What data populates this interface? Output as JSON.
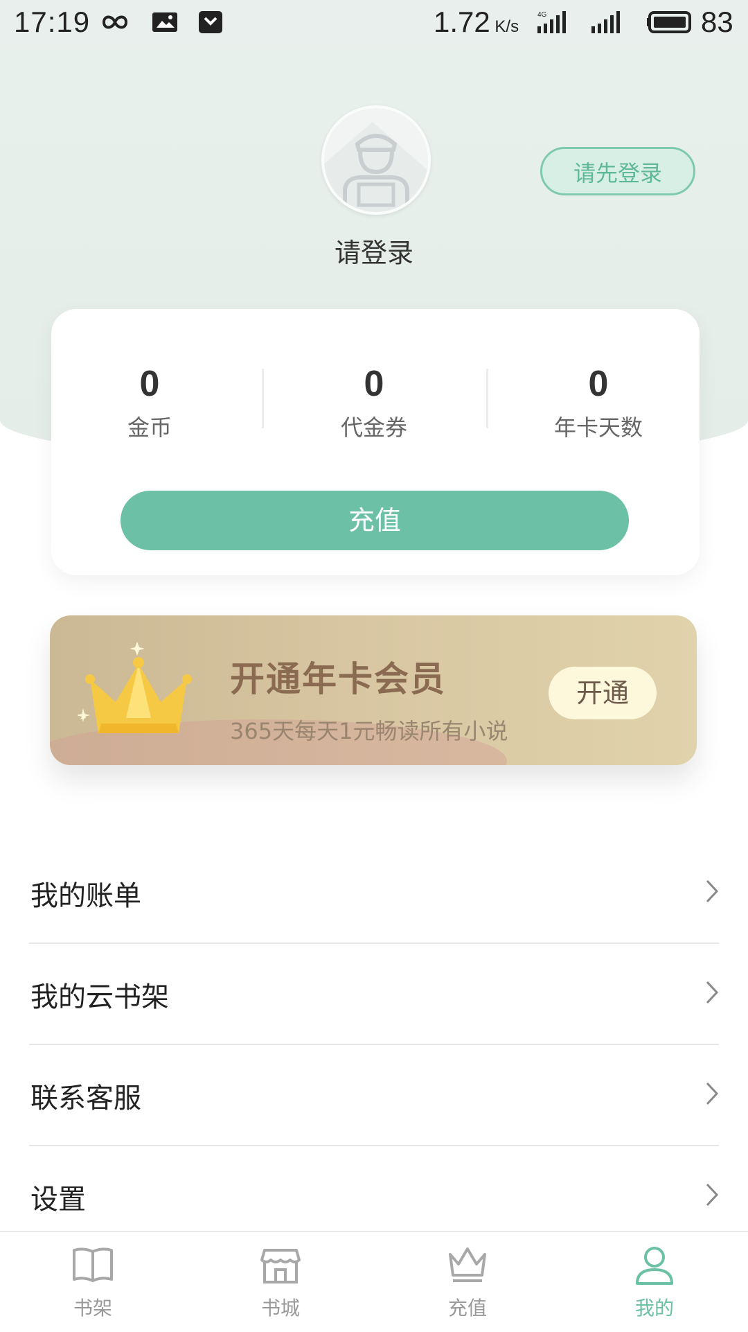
{
  "status_bar": {
    "time": "17:19",
    "speed": "1.72",
    "speed_unit": "K/s",
    "network": "4G",
    "battery": "83"
  },
  "profile": {
    "username": "请登录",
    "login_button": "请先登录"
  },
  "stats": [
    {
      "value": "0",
      "label": "金币"
    },
    {
      "value": "0",
      "label": "代金券"
    },
    {
      "value": "0",
      "label": "年卡天数"
    }
  ],
  "recharge_button": "充值",
  "vip_banner": {
    "title": "开通年卡会员",
    "subtitle": "365天每天1元畅读所有小说",
    "button": "开通"
  },
  "menu": [
    {
      "label": "我的账单"
    },
    {
      "label": "我的云书架"
    },
    {
      "label": "联系客服"
    },
    {
      "label": "设置"
    }
  ],
  "tabs": [
    {
      "label": "书架",
      "icon": "book-icon"
    },
    {
      "label": "书城",
      "icon": "store-icon"
    },
    {
      "label": "充值",
      "icon": "crown-icon"
    },
    {
      "label": "我的",
      "icon": "user-icon",
      "active": true
    }
  ],
  "colors": {
    "accent": "#6bc0a6",
    "vip_gold": "#cbb894"
  }
}
